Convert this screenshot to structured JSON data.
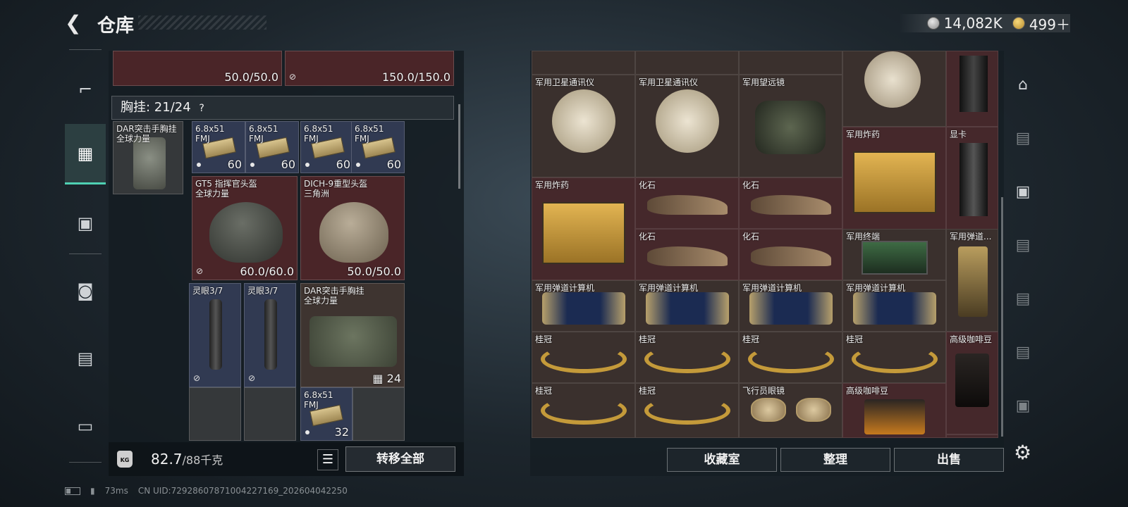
{
  "header": {
    "title": "仓库",
    "currency1": "14,082K",
    "currency2": "499＋"
  },
  "left_nav": [
    "gun-icon",
    "chest-rig-icon",
    "backpack-icon",
    "bag-icon",
    "case-icon",
    "toolbox-icon"
  ],
  "left_panel": {
    "top_items": [
      {
        "value": "50.0/50.0"
      },
      {
        "value": "150.0/150.0"
      }
    ],
    "section_header": "胸挂: 21/24",
    "section_help": "?",
    "rig": {
      "name": "DAR突击手胸挂",
      "sub": "全球力量"
    },
    "ammo": [
      {
        "name": "6.8x51",
        "sub": "FMJ",
        "count": "60"
      },
      {
        "name": "6.8x51",
        "sub": "FMJ",
        "count": "60"
      },
      {
        "name": "6.8x51",
        "sub": "FMJ",
        "count": "60"
      },
      {
        "name": "6.8x51",
        "sub": "FMJ",
        "count": "60"
      }
    ],
    "helmet1": {
      "name": "GT5 指挥官头盔",
      "sub": "全球力量",
      "value": "60.0/60.0"
    },
    "helmet2": {
      "name": "DICH-9重型头盔",
      "sub": "三角洲",
      "value": "50.0/50.0"
    },
    "scope1": {
      "name": "灵眼3/7"
    },
    "scope2": {
      "name": "灵眼3/7"
    },
    "bag": {
      "name": "DAR突击手胸挂",
      "sub": "全球力量",
      "value": "24"
    },
    "ammo_small": {
      "name": "6.8x51",
      "sub": "FMJ",
      "count": "32"
    }
  },
  "bottom_left": {
    "kg_label": "KG",
    "weight": "82.7",
    "weight_max": "/88千克",
    "list_icon": "list-icon",
    "move_all": "转移全部"
  },
  "right_grid": {
    "items": [
      {
        "name": "军用卫星通讯仪"
      },
      {
        "name": "军用卫星通讯仪"
      },
      {
        "name": "军用望远镜"
      },
      {
        "name": "军用炸药"
      },
      {
        "name": "显卡"
      },
      {
        "name": "军用炸药"
      },
      {
        "name": "化石"
      },
      {
        "name": "化石"
      },
      {
        "name": "化石"
      },
      {
        "name": "化石"
      },
      {
        "name": "军用终端"
      },
      {
        "name": "军用弹道..."
      },
      {
        "name": "军用弹道计算机"
      },
      {
        "name": "军用弹道计算机"
      },
      {
        "name": "军用弹道计算机"
      },
      {
        "name": "军用弹道计算机"
      },
      {
        "name": "桂冠"
      },
      {
        "name": "桂冠"
      },
      {
        "name": "桂冠"
      },
      {
        "name": "桂冠"
      },
      {
        "name": "高级咖啡豆"
      },
      {
        "name": "桂冠"
      },
      {
        "name": "桂冠"
      },
      {
        "name": "飞行员眼镜"
      },
      {
        "name": "高级咖啡豆"
      }
    ]
  },
  "right_buttons": {
    "collection": "收藏室",
    "organize": "整理",
    "sell": "出售"
  },
  "right_nav": [
    "safehouse-icon",
    "storage-iv-icon",
    "storage-v-icon",
    "storage-iv-icon",
    "storage-iv-icon",
    "storage-iv-icon",
    "storage-v-icon",
    "gear-icon"
  ],
  "status": {
    "ping": "73ms",
    "uid": "CN UID:7292860787100422716­9_202604042250"
  },
  "colors": {
    "accent": "#4fd0b3",
    "red_cell": "#4a2528",
    "blue_cell": "#313a52"
  }
}
